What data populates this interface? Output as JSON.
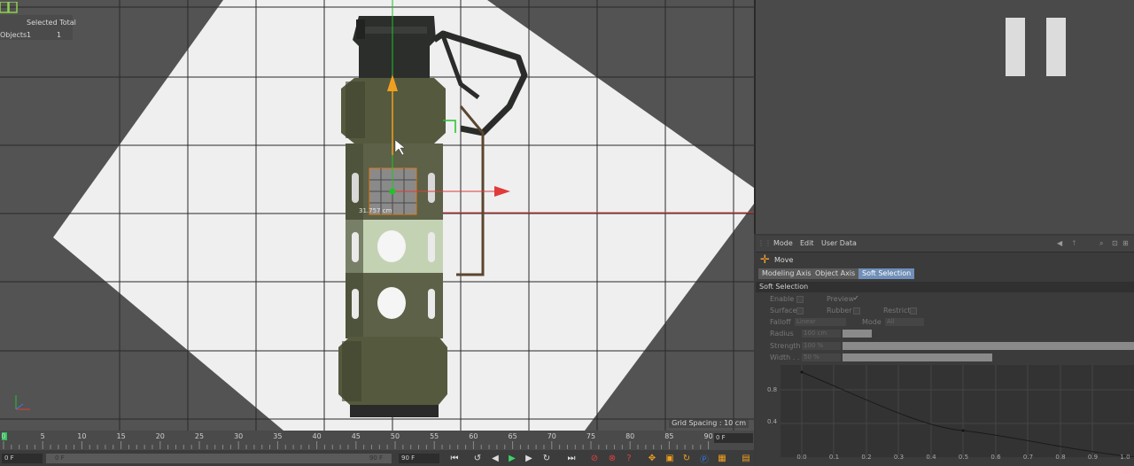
{
  "viewport": {
    "stats_header": "Selected Total",
    "stats_row_label": "Objects",
    "stats_selected": "1",
    "stats_total": "1",
    "measure_label": "31.757 cm",
    "grid_spacing": "Grid Spacing : 10 cm"
  },
  "timeline": {
    "ticks": [
      "0",
      "5",
      "10",
      "15",
      "20",
      "25",
      "30",
      "35",
      "40",
      "45",
      "50",
      "55",
      "60",
      "65",
      "70",
      "75",
      "80",
      "85",
      "90"
    ],
    "current_frame": "0 F",
    "start_field": "0 F",
    "range_start": "0 F",
    "range_end": "90 F",
    "end_field": "90 F"
  },
  "attributes": {
    "menu": [
      "Mode",
      "Edit",
      "User Data"
    ],
    "tool_name": "Move",
    "tabs": [
      "Modeling Axis",
      "Object Axis",
      "Soft Selection"
    ],
    "active_tab": "Soft Selection",
    "section_title": "Soft Selection",
    "enable_label": "Enable",
    "preview_label": "Preview",
    "preview_check": "✓",
    "surface_label": "Surface",
    "rubber_label": "Rubber",
    "restrict_label": "Restrict",
    "falloff_label": "Falloff",
    "falloff_value": "Linear",
    "mode_label": "Mode",
    "mode_value": "All",
    "radius_label": "Radius",
    "radius_value": "100 cm",
    "strength_label": "Strength",
    "strength_value": "100 %",
    "width_label": "Width . .",
    "width_value": "50 %",
    "graph_y_labels": [
      "0.8",
      "0.4"
    ],
    "graph_x_labels": [
      "0.0",
      "0.1",
      "0.2",
      "0.3",
      "0.4",
      "0.5",
      "0.6",
      "0.7",
      "0.8",
      "0.9",
      "1.0"
    ]
  },
  "colors": {
    "accent_active_tab": "#6f8fb8",
    "axis_y": "#22c22a",
    "axis_x": "#e03a3a",
    "axis_handle": "#f0a020",
    "selection_orange": "#e07a1a"
  }
}
